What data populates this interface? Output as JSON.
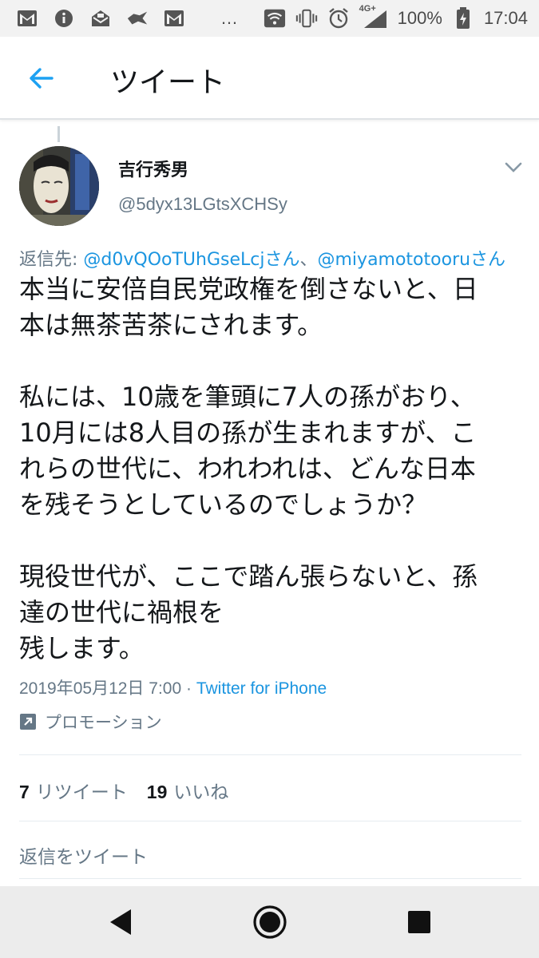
{
  "status_bar": {
    "left_icons": [
      "gmail-icon",
      "info-icon",
      "mail-notification-icon",
      "app-icon",
      "gmail-icon"
    ],
    "more": "…",
    "network": "4G+",
    "battery": "100%",
    "time": "17:04"
  },
  "app_bar": {
    "title": "ツイート"
  },
  "tweet": {
    "author_name": "吉行秀男",
    "author_handle": "@5dyx13LGtsXCHSy",
    "reply_prefix": "返信先: ",
    "reply_mention_1": "@d0vQOoTUhGseLcjさん",
    "reply_separator": "、",
    "reply_mention_2": "@miyamototooruさん",
    "body_lines": [
      "本当に安倍自民党政権を倒さないと、日",
      "本は無茶苦茶にされます。",
      "",
      "私には、10歳を筆頭に7人の孫がおり、",
      "10月には8人目の孫が生まれますが、こ",
      "れらの世代に、われわれは、どんな日本",
      "を残そうとしているのでしょうか？",
      "",
      "現役世代が、ここで踏ん張らないと、孫",
      "達の世代に禍根を",
      "残します。"
    ],
    "timestamp": "2019年05月12日 7:00",
    "meta_separator": " · ",
    "source": "Twitter for iPhone",
    "promotion": "プロモーション"
  },
  "stats": {
    "retweet_count": "7",
    "retweet_label": "リツイート",
    "like_count": "19",
    "like_label": "いいね"
  },
  "reply_box": {
    "placeholder": "返信をツイート"
  },
  "colors": {
    "accent": "#1b95e0",
    "muted": "#657786",
    "text": "#14171a"
  }
}
